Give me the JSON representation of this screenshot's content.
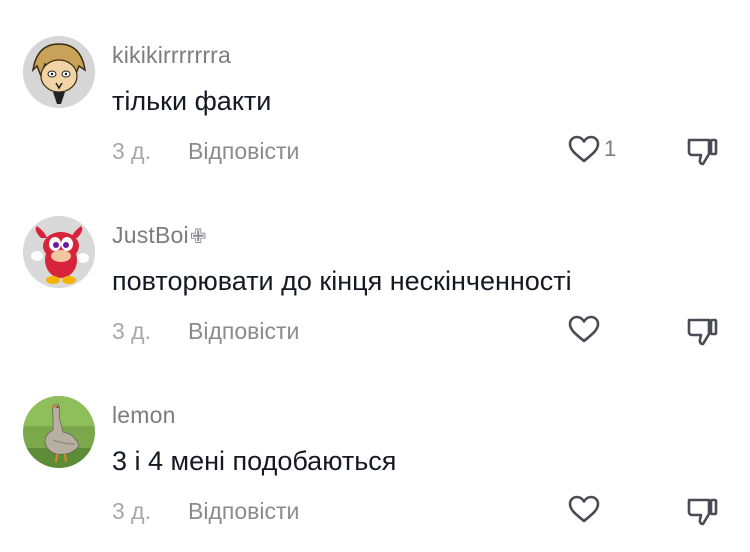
{
  "comments": [
    {
      "username": "kikikirrrrrrra",
      "badge": "",
      "text": "тільки факти",
      "time": "3 д.",
      "reply_label": "Відповісти",
      "like_count": "1",
      "avatar_icon": "anime-character-avatar"
    },
    {
      "username": "JustBoi",
      "badge": "✙",
      "text": "повторювати до кінця нескінченності",
      "time": "3 д.",
      "reply_label": "Відповісти",
      "like_count": "",
      "avatar_icon": "red-knuckles-avatar"
    },
    {
      "username": "lemon",
      "badge": "",
      "text": "3 і 4 мені подобаються",
      "time": "3 д.",
      "reply_label": "Відповісти",
      "like_count": "",
      "avatar_icon": "goose-avatar"
    }
  ],
  "colors": {
    "username": "#7b7b82",
    "text": "#161823",
    "meta": "#a7a7ad",
    "icon": "#4b4b55"
  }
}
